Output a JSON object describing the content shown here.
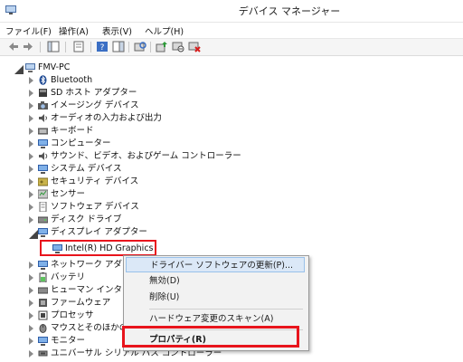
{
  "window": {
    "title": "デバイス マネージャー"
  },
  "menu": [
    "ファイル(F)",
    "操作(A)",
    "表示(V)",
    "ヘルプ(H)"
  ],
  "toolbar": {
    "buttons": [
      "back-icon",
      "forward-icon",
      "show-hide-console-tree-icon",
      "properties-icon",
      "help-icon",
      "action-pane-icon",
      "scan-hardware-icon",
      "update-driver-icon",
      "disable-device-icon",
      "uninstall-device-icon"
    ]
  },
  "tree": {
    "root": "FMV-PC",
    "categories": [
      "Bluetooth",
      "SD ホスト アダプター",
      "イメージング デバイス",
      "オーディオの入力および出力",
      "キーボード",
      "コンピューター",
      "サウンド、ビデオ、およびゲーム コントローラー",
      "システム デバイス",
      "セキュリティ デバイス",
      "センサー",
      "ソフトウェア デバイス",
      "ディスク ドライブ",
      "ディスプレイ アダプター"
    ],
    "display_child": "Intel(R) HD Graphics",
    "categories_after": [
      "ネットワーク アダプター",
      "バッテリ",
      "ヒューマン インターフェ",
      "ファームウェア",
      "プロセッサ",
      "マウスとそのほかのポ",
      "モニター",
      "ユニバーサル シリアル バス コントローラー"
    ]
  },
  "context_menu": {
    "items": [
      "ドライバー ソフトウェアの更新(P)...",
      "無効(D)",
      "削除(U)",
      "ハードウェア変更のスキャン(A)",
      "プロパティ(R)"
    ]
  },
  "colors": {
    "highlight_red": "#e8141c",
    "menu_hover": "#dbe8f7"
  }
}
